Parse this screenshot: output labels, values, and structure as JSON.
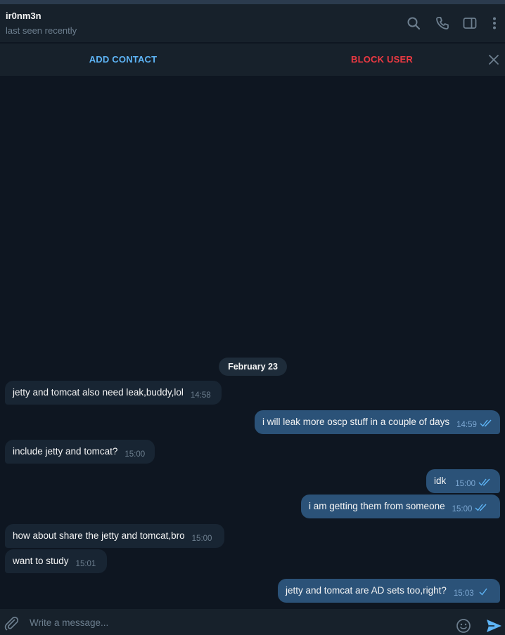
{
  "header": {
    "name": "ir0nm3n",
    "status": "last seen recently",
    "icons": [
      "search-icon",
      "phone-icon",
      "sidebar-toggle-icon",
      "more-icon"
    ]
  },
  "action_bar": {
    "add_contact": "ADD CONTACT",
    "block_user": "BLOCK USER"
  },
  "chat": {
    "date": "February 23",
    "messages": [
      {
        "dir": "in",
        "text": "jetty and tomcat also need leak,buddy,lol",
        "time": "14:58"
      },
      {
        "dir": "out",
        "text": "i will leak more oscp stuff in a couple of days",
        "time": "14:59",
        "read": true
      },
      {
        "dir": "in",
        "text": "include jetty and tomcat?",
        "time": "15:00"
      },
      {
        "dir": "out",
        "text": "idk",
        "time": "15:00",
        "read": true
      },
      {
        "dir": "out",
        "text": "i am getting them from someone",
        "time": "15:00",
        "read": true
      },
      {
        "dir": "in",
        "text": "how about share the jetty and tomcat,bro",
        "time": "15:00"
      },
      {
        "dir": "in",
        "text": "want to study",
        "time": "15:01"
      },
      {
        "dir": "out",
        "text": "jetty and tomcat are AD sets too,right?",
        "time": "15:03",
        "read": false
      }
    ]
  },
  "composer": {
    "placeholder": "Write a message..."
  },
  "colors": {
    "background": "#0e1621",
    "panel": "#17212b",
    "incoming_bubble": "#182533",
    "outgoing_bubble": "#2b5278",
    "accent": "#5eb5f7",
    "danger": "#ec3942"
  }
}
